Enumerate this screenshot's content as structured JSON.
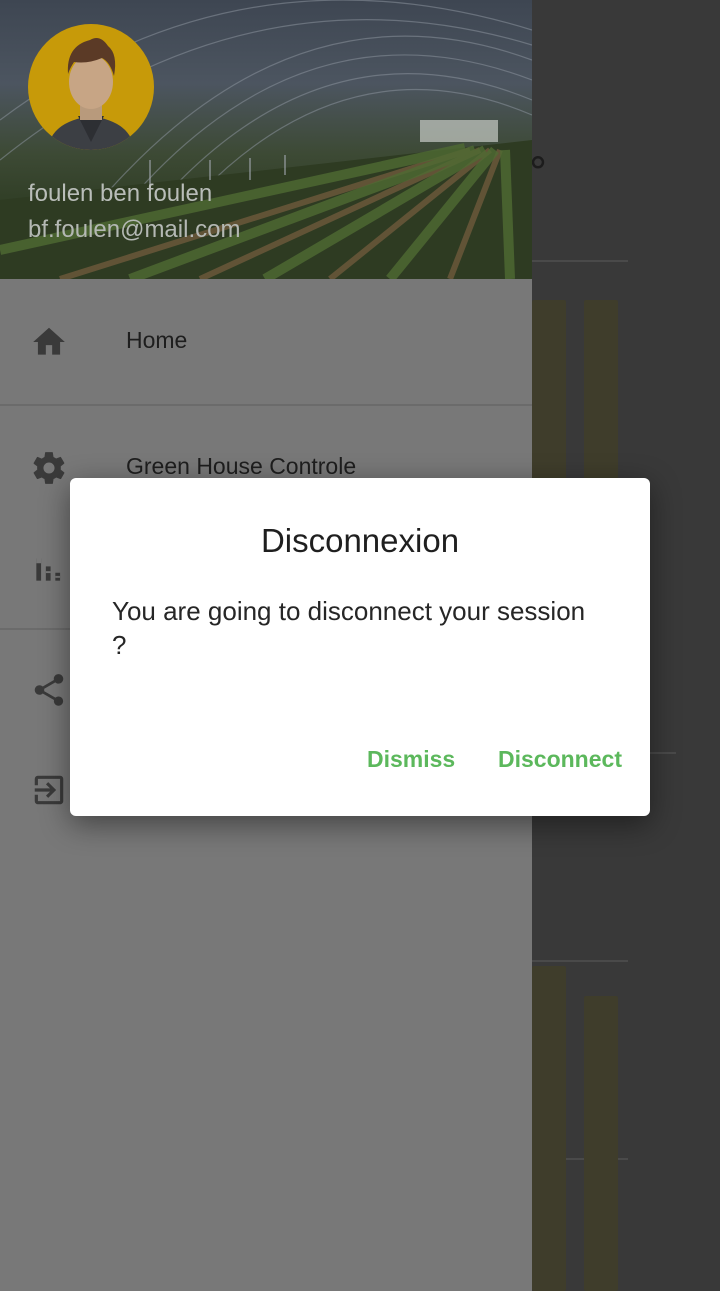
{
  "drawer": {
    "user_name": "foulen ben foulen",
    "user_email": "bf.foulen@mail.com",
    "items": [
      {
        "label": "Home",
        "icon": "home-icon"
      },
      {
        "label": "Green House Controle",
        "icon": "gear-icon"
      },
      {
        "label": "",
        "icon": "stats-icon"
      },
      {
        "label": "",
        "icon": "share-icon"
      },
      {
        "label": "",
        "icon": "logout-icon"
      }
    ]
  },
  "background": {
    "degree_symbol": "°"
  },
  "dialog": {
    "title": "Disconnexion",
    "message": "You are going to disconnect your session ?",
    "dismiss_label": "Dismiss",
    "confirm_label": "Disconnect"
  },
  "colors": {
    "accent": "#5cb85c",
    "avatar_bg": "#c79a09",
    "scrim_drawer": "#787878"
  }
}
